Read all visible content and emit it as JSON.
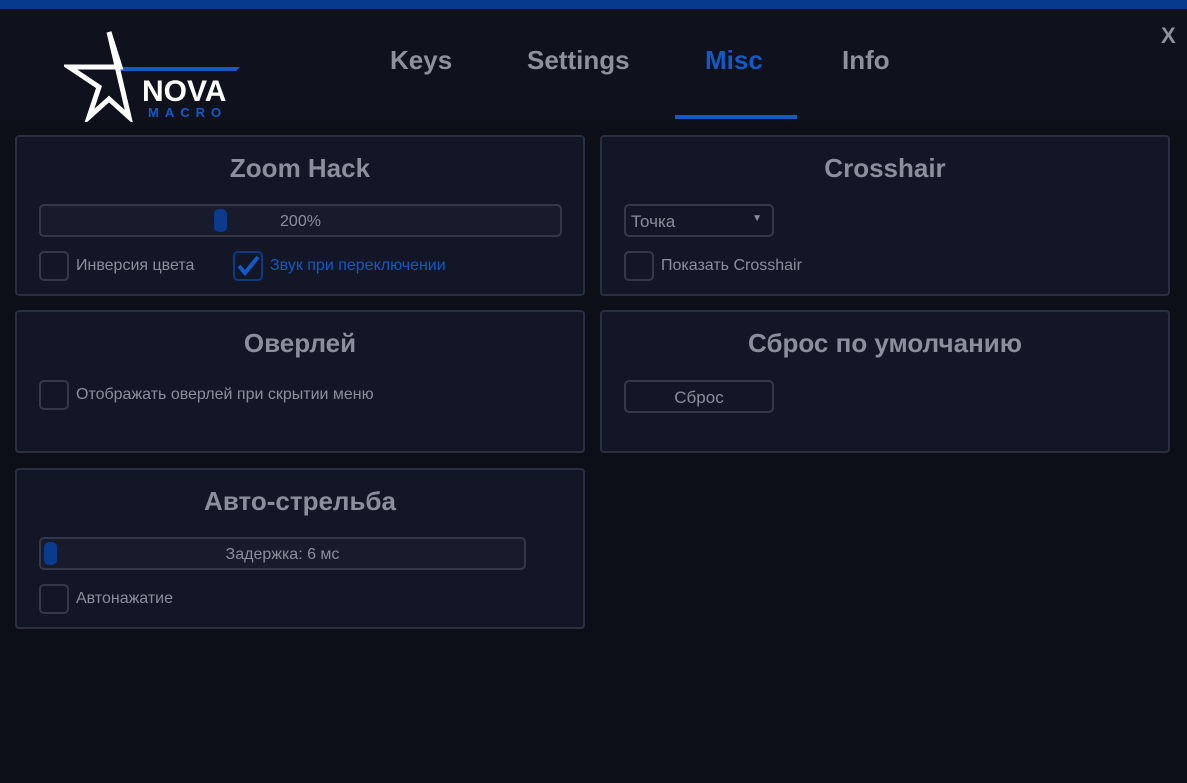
{
  "header": {
    "logo_text": "NOVA",
    "logo_sub": "MACRO",
    "tabs": [
      {
        "label": "Keys"
      },
      {
        "label": "Settings"
      },
      {
        "label": "Misc",
        "active": true
      },
      {
        "label": "Info"
      }
    ],
    "close_label": "X"
  },
  "colors": {
    "accent": "#1459c4",
    "background": "#0c0e18",
    "panel": "#121626"
  },
  "zoom_hack": {
    "title": "Zoom Hack",
    "slider_value": "200%",
    "slider_fraction": 0.34,
    "invert_label": "Инверсия цвета",
    "invert_checked": false,
    "sound_label": "Звук при переключении",
    "sound_checked": true
  },
  "crosshair": {
    "title": "Crosshair",
    "select_value": "Точка",
    "show_label": "Показать Crosshair",
    "show_checked": false
  },
  "overlay": {
    "title": "Оверлей",
    "show_label": "Отображать оверлей при скрытии меню",
    "show_checked": false
  },
  "reset": {
    "title": "Сброс по умолчанию",
    "button_label": "Сброс"
  },
  "autofire": {
    "title": "Авто-стрельба",
    "slider_value": "Задержка: 6 мс",
    "slider_fraction": 0.0,
    "autopress_label": "Автонажатие",
    "autopress_checked": false
  }
}
